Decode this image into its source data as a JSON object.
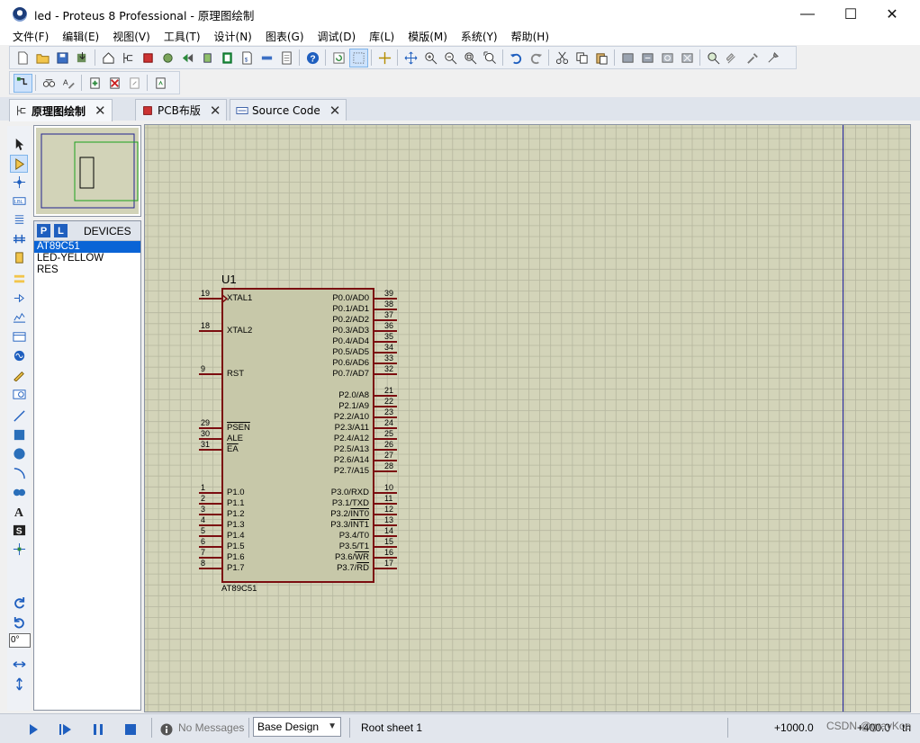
{
  "window": {
    "title": "led - Proteus 8 Professional - 原理图绘制",
    "controls": {
      "minimize": "—",
      "maximize": "☐",
      "close": "✕"
    }
  },
  "menu": [
    "文件(F)",
    "编辑(E)",
    "视图(V)",
    "工具(T)",
    "设计(N)",
    "图表(G)",
    "调试(D)",
    "库(L)",
    "模版(M)",
    "系统(Y)",
    "帮助(H)"
  ],
  "tabs": [
    {
      "label": "原理图绘制",
      "active": true,
      "icon": "schematic-icon"
    },
    {
      "label": "PCB布版",
      "active": false,
      "icon": "pcb-icon"
    },
    {
      "label": "Source Code",
      "active": false,
      "icon": "source-code-icon"
    }
  ],
  "devices": {
    "p_button": "P",
    "l_button": "L",
    "header": "DEVICES",
    "items": [
      "AT89C51",
      "LED-YELLOW",
      "RES"
    ],
    "selected": "AT89C51"
  },
  "left_tools": {
    "angle_value": "0°"
  },
  "schematic": {
    "ref": "U1",
    "part": "AT89C51",
    "left_pins": [
      {
        "num": "19",
        "name": "XTAL1"
      },
      {
        "num": "18",
        "name": "XTAL2"
      },
      {
        "num": "9",
        "name": "RST"
      },
      {
        "num": "29",
        "name": "PSEN"
      },
      {
        "num": "30",
        "name": "ALE"
      },
      {
        "num": "31",
        "name": "EA"
      },
      {
        "num": "1",
        "name": "P1.0"
      },
      {
        "num": "2",
        "name": "P1.1"
      },
      {
        "num": "3",
        "name": "P1.2"
      },
      {
        "num": "4",
        "name": "P1.3"
      },
      {
        "num": "5",
        "name": "P1.4"
      },
      {
        "num": "6",
        "name": "P1.5"
      },
      {
        "num": "7",
        "name": "P1.6"
      },
      {
        "num": "8",
        "name": "P1.7"
      }
    ],
    "right_pins": [
      {
        "num": "39",
        "name": "P0.0/AD0"
      },
      {
        "num": "38",
        "name": "P0.1/AD1"
      },
      {
        "num": "37",
        "name": "P0.2/AD2"
      },
      {
        "num": "36",
        "name": "P0.3/AD3"
      },
      {
        "num": "35",
        "name": "P0.4/AD4"
      },
      {
        "num": "34",
        "name": "P0.5/AD5"
      },
      {
        "num": "33",
        "name": "P0.6/AD6"
      },
      {
        "num": "32",
        "name": "P0.7/AD7"
      },
      {
        "num": "21",
        "name": "P2.0/A8"
      },
      {
        "num": "22",
        "name": "P2.1/A9"
      },
      {
        "num": "23",
        "name": "P2.2/A10"
      },
      {
        "num": "24",
        "name": "P2.3/A11"
      },
      {
        "num": "25",
        "name": "P2.4/A12"
      },
      {
        "num": "26",
        "name": "P2.5/A13"
      },
      {
        "num": "27",
        "name": "P2.6/A14"
      },
      {
        "num": "28",
        "name": "P2.7/A15"
      },
      {
        "num": "10",
        "name": "P3.0/RXD"
      },
      {
        "num": "11",
        "name": "P3.1/TXD"
      },
      {
        "num": "12",
        "name": "P3.2/INT0"
      },
      {
        "num": "13",
        "name": "P3.3/INT1"
      },
      {
        "num": "14",
        "name": "P3.4/T0"
      },
      {
        "num": "15",
        "name": "P3.5/T1"
      },
      {
        "num": "16",
        "name": "P3.6/WR"
      },
      {
        "num": "17",
        "name": "P3.7/RD"
      }
    ]
  },
  "status": {
    "messages": "No Messages",
    "design_select": "Base Design",
    "sheet": "Root sheet 1",
    "x_coord": "+1000.0",
    "y_coord": "+400.0",
    "unit": "th"
  },
  "watermark": "CSDN @grayKoo",
  "colors": {
    "canvas_bg": "#d3d4b9",
    "grid": "#b6b79f",
    "chip_body": "#c7c8a9",
    "chip_outline": "#7b0d10",
    "selection": "#0a64d6"
  }
}
